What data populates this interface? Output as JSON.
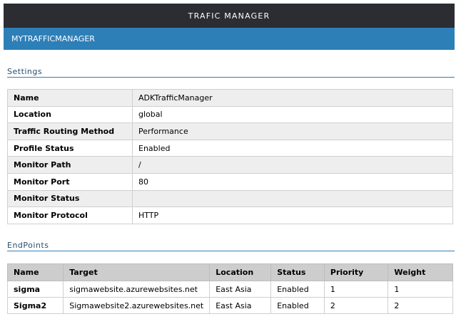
{
  "header": {
    "app_title": "TRAFIC MANAGER"
  },
  "profile": {
    "title": "MYTRAFFICMANAGER"
  },
  "settings": {
    "section_title": "Settings",
    "rows": [
      {
        "key": "Name",
        "value": "ADKTrafficManager"
      },
      {
        "key": "Location",
        "value": "global"
      },
      {
        "key": "Traffic Routing Method",
        "value": "Performance"
      },
      {
        "key": "Profile Status",
        "value": "Enabled"
      },
      {
        "key": "Monitor Path",
        "value": "/"
      },
      {
        "key": "Monitor Port",
        "value": "80"
      },
      {
        "key": "Monitor Status",
        "value": ""
      },
      {
        "key": "Monitor Protocol",
        "value": "HTTP"
      }
    ]
  },
  "endpoints": {
    "section_title": "EndPoints",
    "columns": [
      "Name",
      "Target",
      "Location",
      "Status",
      "Priority",
      "Weight"
    ],
    "rows": [
      [
        "sigma",
        "sigmawebsite.azurewebsites.net",
        "East Asia",
        "Enabled",
        "1",
        "1"
      ],
      [
        "Sigma2",
        "Sigmawebsite2.azurewebsites.net",
        "East Asia",
        "Enabled",
        "2",
        "2"
      ]
    ]
  }
}
